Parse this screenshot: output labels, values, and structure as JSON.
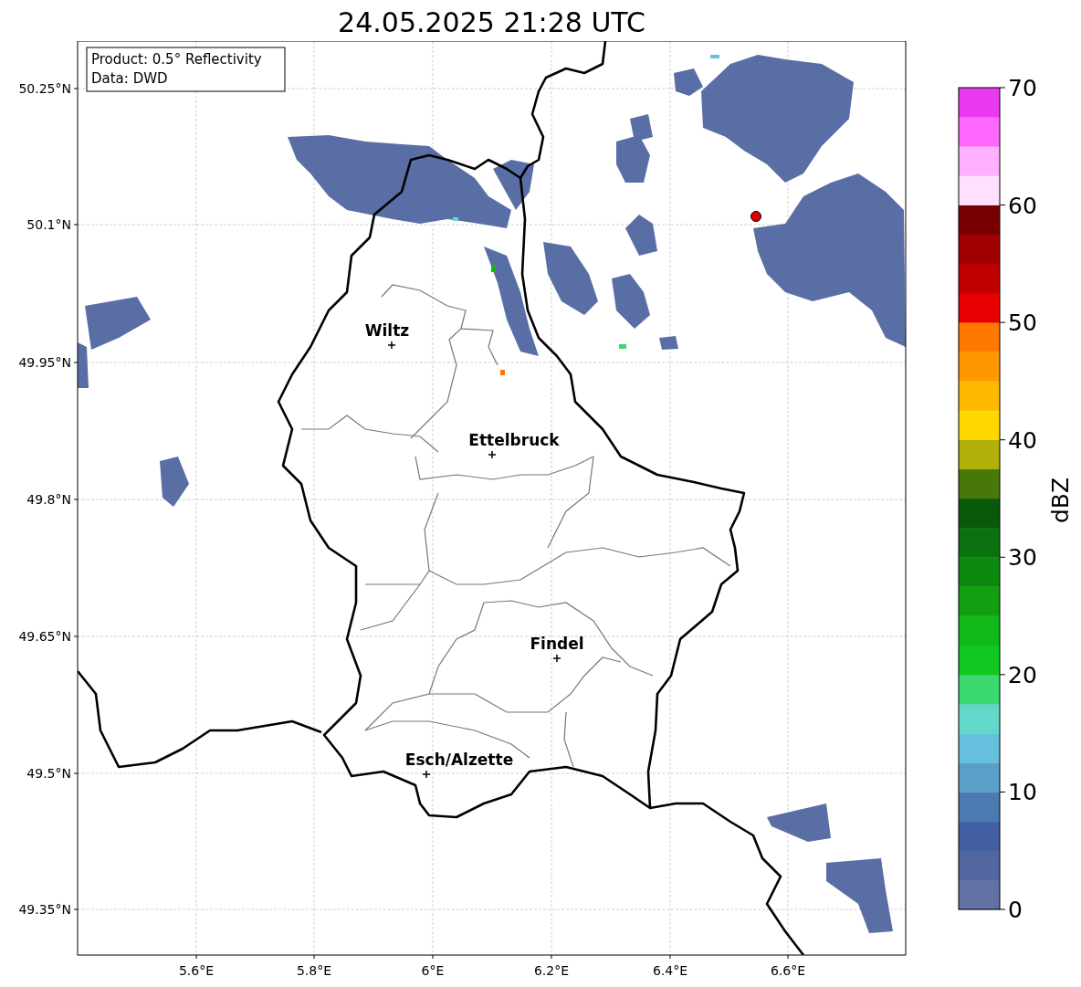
{
  "title": "24.05.2025 21:28 UTC",
  "info_box": {
    "lines": [
      "Product: 0.5° Reflectivity",
      "Data: DWD"
    ]
  },
  "y_ticks": [
    "50.25°N",
    "50.1°N",
    "49.95°N",
    "49.8°N",
    "49.65°N",
    "49.5°N",
    "49.35°N"
  ],
  "x_ticks": [
    "5.6°E",
    "5.8°E",
    "6°E",
    "6.2°E",
    "6.4°E",
    "6.6°E"
  ],
  "places": [
    {
      "name": "Wiltz"
    },
    {
      "name": "Ettelbruck"
    },
    {
      "name": "Findel"
    },
    {
      "name": "Esch/Alzette"
    }
  ],
  "colorbar": {
    "label": "dBZ",
    "ticks": [
      "70",
      "60",
      "50",
      "40",
      "30",
      "20",
      "10",
      "0"
    ],
    "bins": [
      {
        "color": "#6272a4"
      },
      {
        "color": "#5466a0"
      },
      {
        "color": "#4460a4"
      },
      {
        "color": "#4a7ab0"
      },
      {
        "color": "#58a0c8"
      },
      {
        "color": "#64c0dc"
      },
      {
        "color": "#64d8c8"
      },
      {
        "color": "#3cd870"
      },
      {
        "color": "#10c820"
      },
      {
        "color": "#10b818"
      },
      {
        "color": "#10a010"
      },
      {
        "color": "#0c8a10"
      },
      {
        "color": "#0a7010"
      },
      {
        "color": "#085a0a"
      },
      {
        "color": "#48780a"
      },
      {
        "color": "#b0b008"
      },
      {
        "color": "#ffd800"
      },
      {
        "color": "#ffb800"
      },
      {
        "color": "#ff9800"
      },
      {
        "color": "#ff7800"
      },
      {
        "color": "#e80000"
      },
      {
        "color": "#c00000"
      },
      {
        "color": "#a00000"
      },
      {
        "color": "#780000"
      },
      {
        "color": "#ffe0ff"
      },
      {
        "color": "#ffb0ff"
      },
      {
        "color": "#ff68ff"
      },
      {
        "color": "#e838f0"
      }
    ]
  }
}
